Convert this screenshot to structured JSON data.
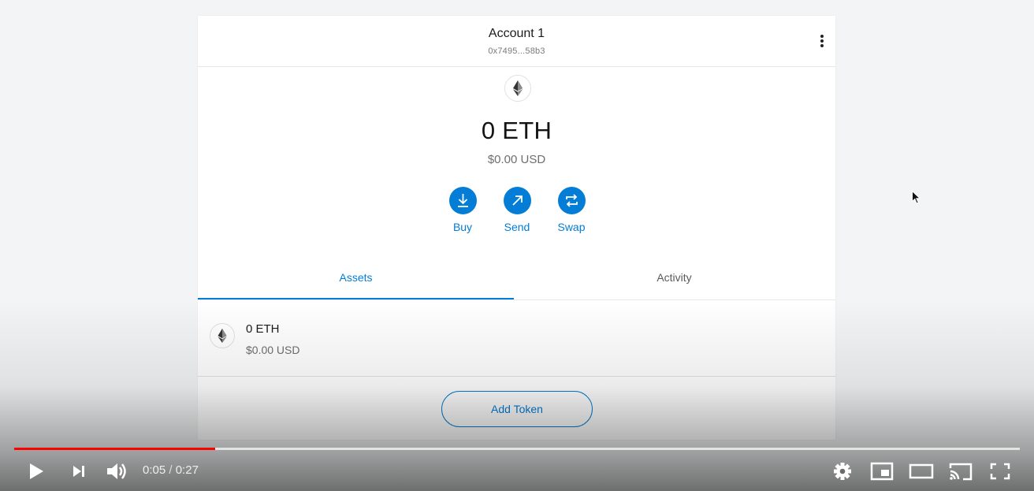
{
  "wallet": {
    "account_name": "Account 1",
    "account_address": "0x7495...58b3",
    "balance": "0 ETH",
    "balance_usd": "$0.00 USD",
    "actions": [
      {
        "label": "Buy",
        "icon": "download-icon"
      },
      {
        "label": "Send",
        "icon": "arrow-up-right-icon"
      },
      {
        "label": "Swap",
        "icon": "swap-icon"
      }
    ],
    "tabs": [
      {
        "label": "Assets",
        "active": true
      },
      {
        "label": "Activity",
        "active": false
      }
    ],
    "assets": [
      {
        "amount": "0 ETH",
        "usd": "$0.00 USD",
        "icon": "ethereum-icon"
      }
    ],
    "add_token_label": "Add Token",
    "accent_color": "#037dd6"
  },
  "player": {
    "current_time": "0:05",
    "separator": " / ",
    "duration": "0:27",
    "played_fraction": 0.2,
    "loaded_fraction": 1.0,
    "progress_color": "#ff0000",
    "controls": [
      "play-icon",
      "next-icon",
      "volume-icon",
      "settings-icon",
      "miniplayer-icon",
      "theater-mode-icon",
      "cast-icon",
      "fullscreen-icon"
    ]
  }
}
